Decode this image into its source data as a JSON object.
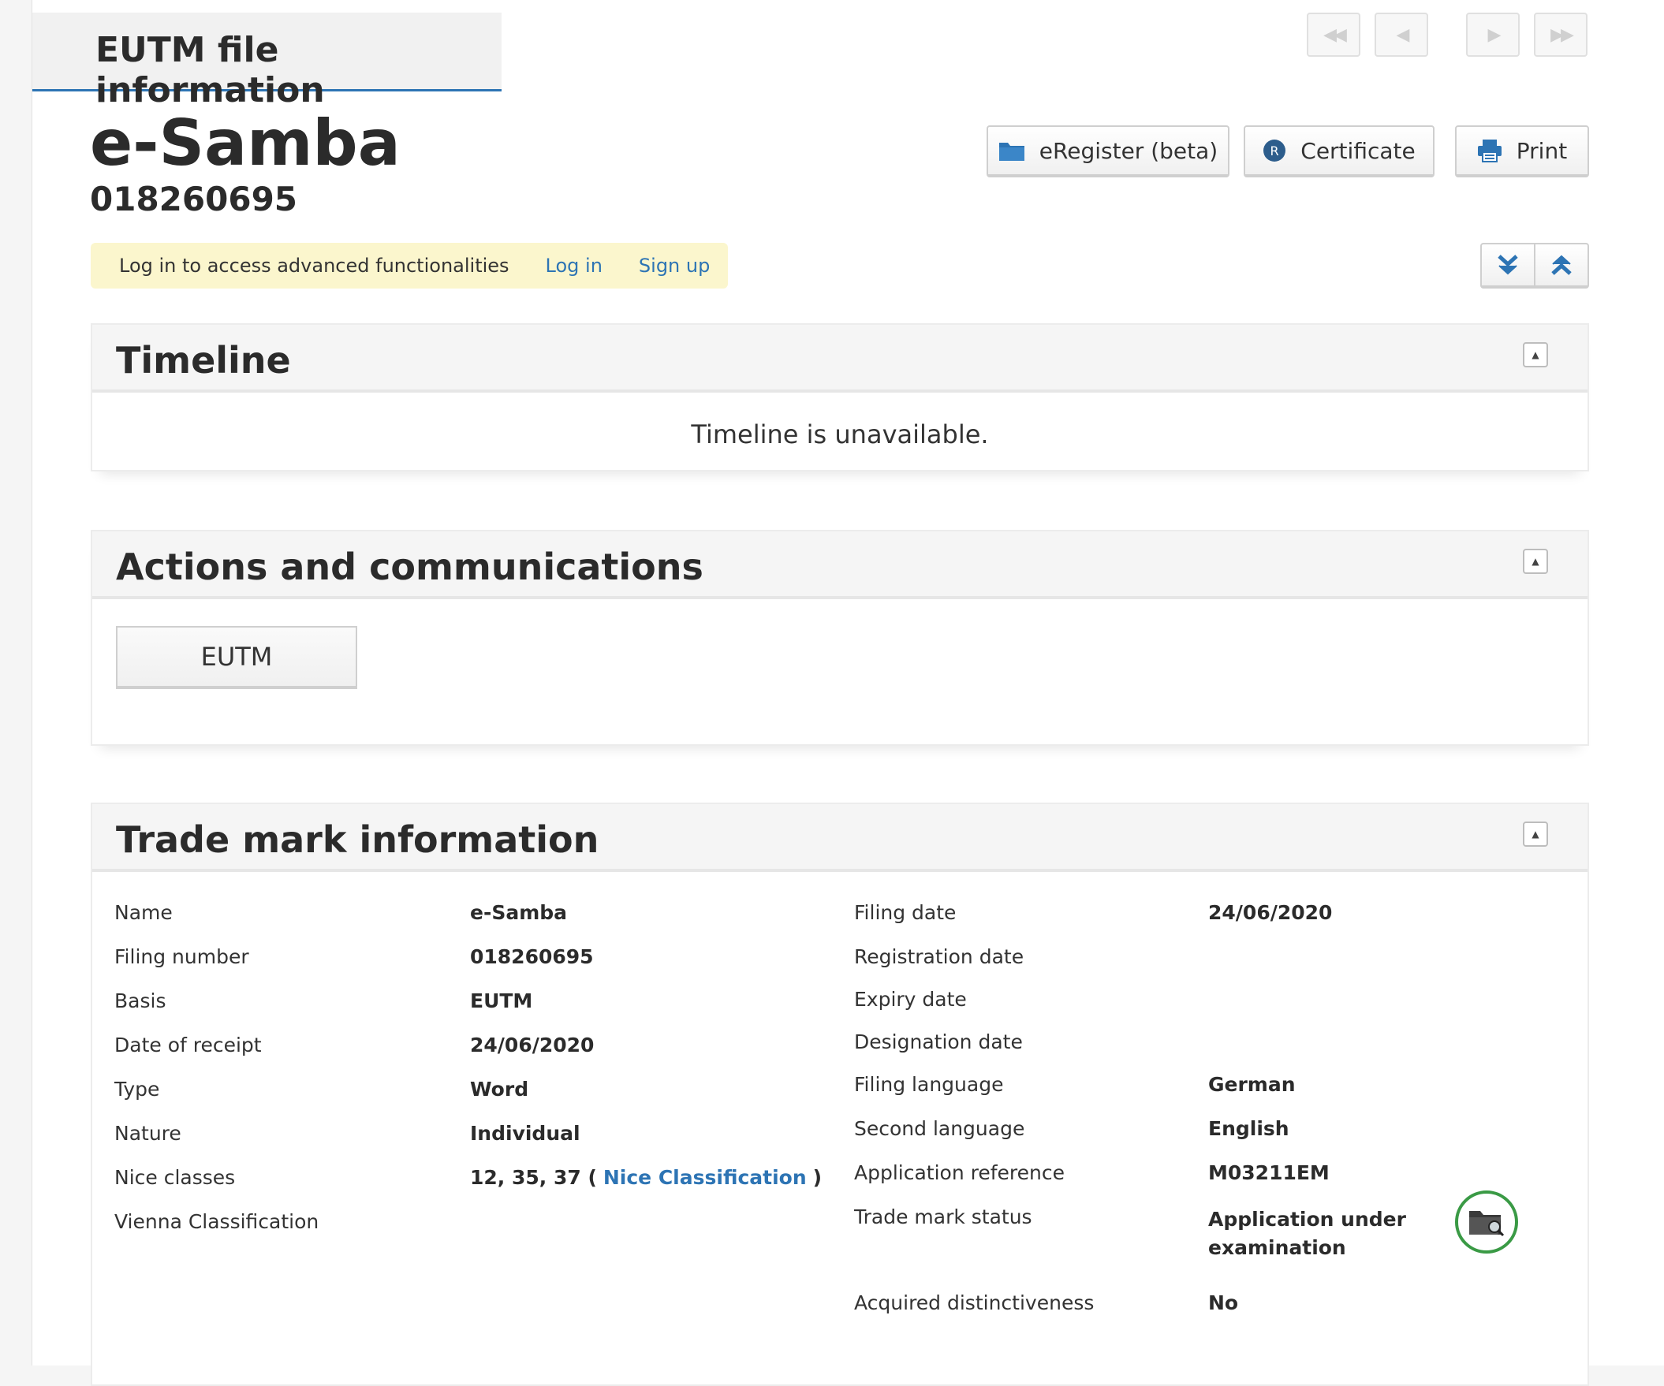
{
  "header": {
    "tab_title": "EUTM file information",
    "nav": {
      "first": "first-page-icon",
      "prev": "previous-page-icon",
      "next": "next-page-icon",
      "last": "last-page-icon"
    }
  },
  "mark": {
    "name": "e-Samba",
    "number": "018260695"
  },
  "toolbar": {
    "eregister_label": "eRegister (beta)",
    "certificate_label": "Certificate",
    "print_label": "Print"
  },
  "login_banner": {
    "text": "Log in to access advanced functionalities",
    "login_link": "Log in",
    "signup_link": "Sign up"
  },
  "timeline": {
    "title": "Timeline",
    "message": "Timeline is unavailable."
  },
  "actions": {
    "title": "Actions and communications",
    "button_label": "EUTM"
  },
  "trademark": {
    "title": "Trade mark information",
    "left": [
      {
        "label": "Name",
        "value": "e-Samba"
      },
      {
        "label": "Filing number",
        "value": "018260695"
      },
      {
        "label": "Basis",
        "value": "EUTM"
      },
      {
        "label": "Date of receipt",
        "value": "24/06/2020"
      },
      {
        "label": "Type",
        "value": "Word"
      },
      {
        "label": "Nature",
        "value": "Individual"
      },
      {
        "label": "Nice classes",
        "value": "12, 35, 37 (",
        "link": "Nice Classification",
        "suffix": ")"
      },
      {
        "label": "Vienna Classification",
        "value": ""
      }
    ],
    "right": [
      {
        "label": "Filing date",
        "value": "24/06/2020"
      },
      {
        "label": "Registration date",
        "value": ""
      },
      {
        "label": "Expiry date",
        "value": ""
      },
      {
        "label": "Designation date",
        "value": ""
      },
      {
        "label": "Filing language",
        "value": "German"
      },
      {
        "label": "Second language",
        "value": "English"
      },
      {
        "label": "Application reference",
        "value": "M03211EM"
      },
      {
        "label": "Trade mark status",
        "value_line1": "Application under",
        "value_line2": "examination"
      },
      {
        "label": "Acquired distinctiveness",
        "value": "No"
      }
    ]
  },
  "colors": {
    "accent": "#2d74b4",
    "banner": "#fbf6cd",
    "status_ring": "#3a9a45"
  }
}
